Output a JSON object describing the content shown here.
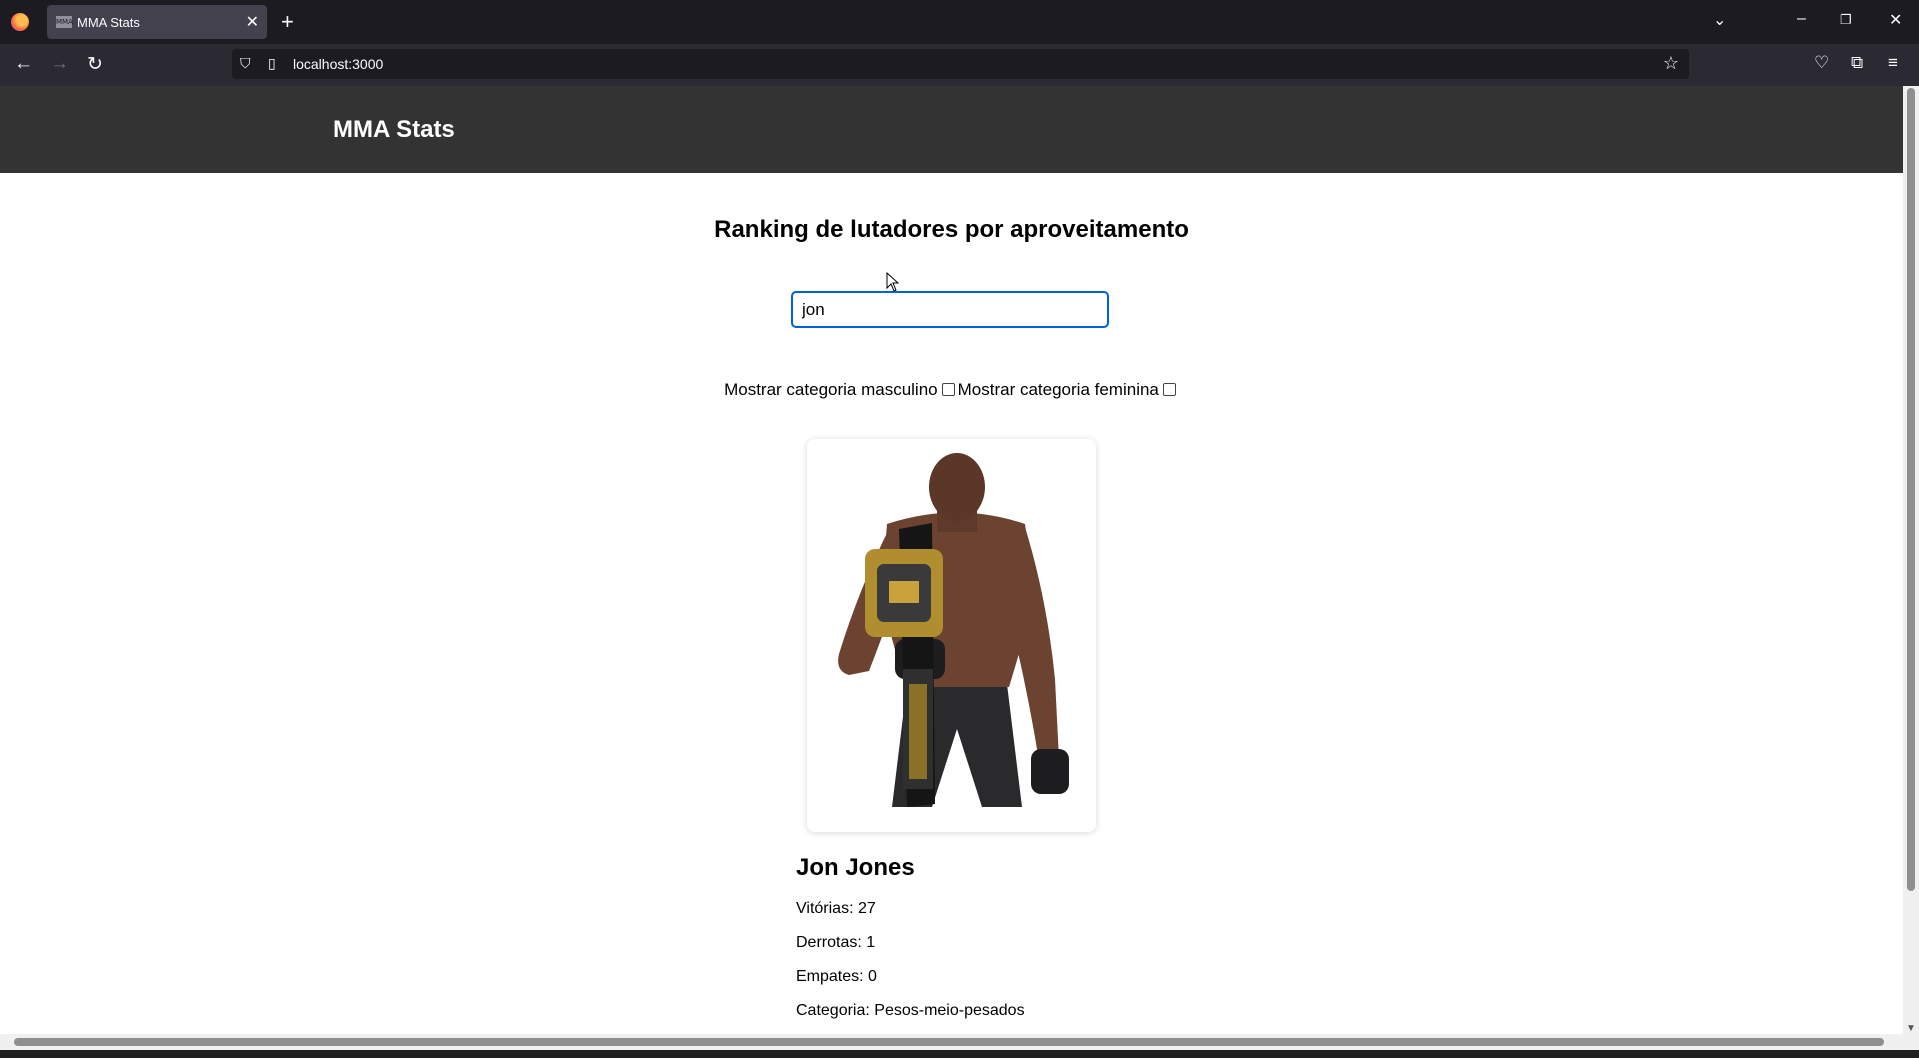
{
  "browser": {
    "tab_title": "MMA Stats",
    "tab_favicon": "MMA",
    "url": "localhost:3000"
  },
  "site": {
    "title": "MMA Stats"
  },
  "page": {
    "heading": "Ranking de lutadores por aproveitamento",
    "search_value": "jon",
    "filter_male_label": "Mostrar categoria masculino",
    "filter_male_checked": false,
    "filter_female_label": "Mostrar categoria feminina",
    "filter_female_checked": false
  },
  "fighter": {
    "name": "Jon Jones",
    "wins": "Vitórias: 27",
    "losses": "Derrotas: 1",
    "draws": "Empates: 0",
    "category": "Categoria: Pesos-meio-pesados",
    "photo_icon": "fighter-photo"
  },
  "colors": {
    "header_bg": "#333333",
    "focus_border": "#0060df",
    "browser_chrome": "#1c1b22"
  }
}
